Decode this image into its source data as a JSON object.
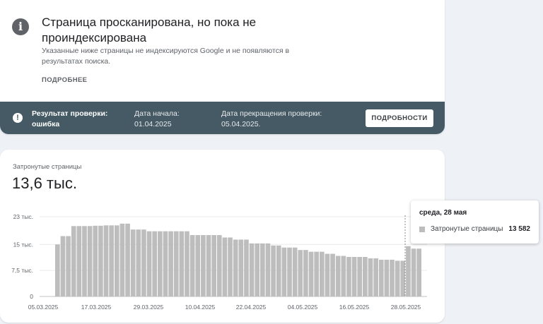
{
  "issue": {
    "title": "Страница просканирована, но пока не проиндексирована",
    "description": "Указанные ниже страницы не индексируются Google и не появляются в результатах поиска.",
    "more_label": "ПОДРОБНЕЕ",
    "icon": "info-icon"
  },
  "validation": {
    "status_label": "Результат проверки: ошибка",
    "start_label": "Дата начала: 01.04.2025",
    "end_label": "Дата прекращения проверки: 05.04.2025.",
    "details_button": "ПОДРОБНОСТИ",
    "icon": "alert-icon",
    "background_color": "#455a64"
  },
  "metric": {
    "label": "Затронутые страницы",
    "value": "13,6 тыс."
  },
  "tooltip": {
    "date": "среда, 28 мая",
    "series": "Затронутые страницы",
    "value": "13 582"
  },
  "chart_data": {
    "type": "bar",
    "x_tick_labels": [
      "05.03.2025",
      "17.03.2025",
      "29.03.2025",
      "10.04.2025",
      "22.04.2025",
      "04.05.2025",
      "16.05.2025",
      "28.05.2025"
    ],
    "y_tick_labels": [
      "0",
      "7,5 тыс.",
      "15 тыс.",
      "23 тыс."
    ],
    "ylim": [
      0,
      23000
    ],
    "bar_color": "#bdbdbd",
    "highlight_category": "28.05.2025",
    "series": [
      {
        "values": [
          15000,
          17400,
          17400,
          20300,
          20300,
          20300,
          20300,
          20400,
          20400,
          20500,
          20500,
          20500,
          21000,
          21000,
          19300,
          19300,
          19300,
          18800,
          18800,
          18800,
          18800,
          18800,
          18800,
          18800,
          18800,
          17700,
          17700,
          17700,
          17700,
          17700,
          17700,
          17000,
          17000,
          16400,
          16400,
          16400,
          15300,
          15300,
          15300,
          15300,
          14700,
          14700,
          14100,
          14100,
          14100,
          13400,
          13400,
          12900,
          12900,
          12900,
          12300,
          12300,
          11700,
          11700,
          11400,
          11400,
          11400,
          11400,
          11000,
          11000,
          10600,
          10600,
          10600,
          10300,
          10300,
          14500,
          13800,
          13800
        ]
      }
    ]
  }
}
